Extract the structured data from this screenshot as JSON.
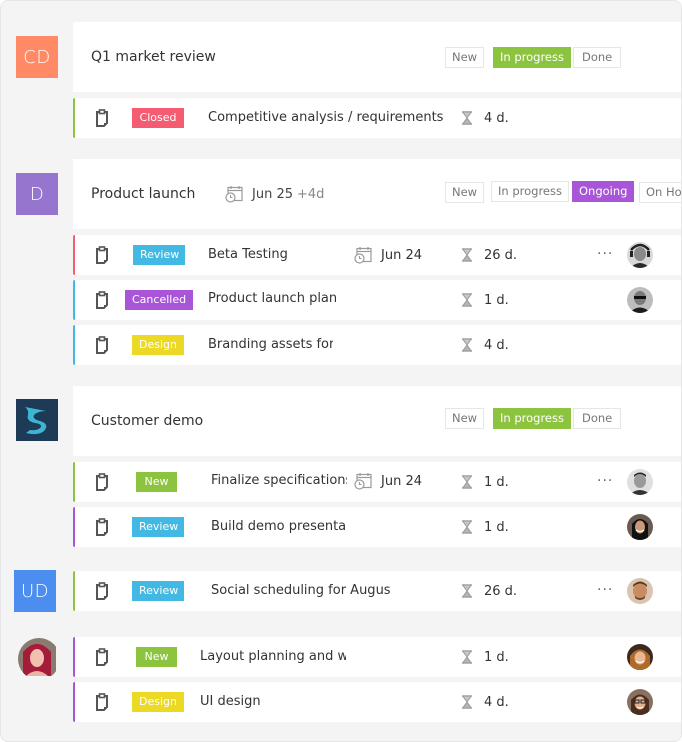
{
  "colors": {
    "green": "#8cc43f",
    "blue": "#41b9e3",
    "red": "#f55b71",
    "purple": "#a855d8",
    "yellow": "#ecd926",
    "orange_avatar": "#ff8a65",
    "purple_avatar": "#9575cd",
    "blue_avatar": "#4b8ef0"
  },
  "groups": [
    {
      "owner": {
        "initials": "CD",
        "type": "initials"
      },
      "title": "Q1 market review",
      "statuses": [
        {
          "label": "New",
          "active": false
        },
        {
          "label": "In progress",
          "active": true
        },
        {
          "label": "Done",
          "active": false
        }
      ],
      "tasks": [
        {
          "badge": "Closed",
          "name": "Competitive analysis / requirements",
          "duration": "4 d."
        }
      ]
    },
    {
      "owner": {
        "initials": "D",
        "type": "initials"
      },
      "title": "Product launch",
      "date": "Jun 25",
      "date_extra": "+4d",
      "statuses": [
        {
          "label": "New",
          "active": false
        },
        {
          "label": "In progress",
          "active": false
        },
        {
          "label": "Ongoing",
          "active": true
        },
        {
          "label": "On Hold",
          "active": false
        }
      ],
      "tasks": [
        {
          "badge": "Review",
          "name": "Beta Testing",
          "date": "Jun 24",
          "duration": "26 d.",
          "more": "···",
          "assignee": "man-headphones"
        },
        {
          "badge": "Cancelled",
          "name": "Product launch plan",
          "duration": "1 d.",
          "assignee": "man-glasses"
        },
        {
          "badge": "Design",
          "name": "Branding assets for",
          "duration": "4 d."
        }
      ]
    },
    {
      "owner": {
        "type": "logo",
        "logo_letter": "S"
      },
      "title": "Customer demo",
      "statuses": [
        {
          "label": "New",
          "active": false
        },
        {
          "label": "In progress",
          "active": true
        },
        {
          "label": "Done",
          "active": false
        }
      ],
      "tasks": [
        {
          "badge": "New",
          "name": "Finalize specifications",
          "date": "Jun 24",
          "duration": "1 d.",
          "more": "···",
          "assignee": "man-short-hair"
        },
        {
          "badge": "Review",
          "name": "Build demo presentati",
          "duration": "1 d.",
          "assignee": "woman-dark-hair"
        }
      ]
    },
    {
      "owner": {
        "initials": "UD",
        "type": "initials"
      },
      "tasks": [
        {
          "badge": "Review",
          "name": "Social scheduling for August",
          "duration": "26 d.",
          "more": "···",
          "assignee": "man-beard"
        }
      ]
    },
    {
      "owner": {
        "type": "photo",
        "photo": "woman-red-hair"
      },
      "tasks": [
        {
          "badge": "New",
          "name": "Layout planning and wir",
          "duration": "1 d.",
          "assignee": "woman-blonde"
        },
        {
          "badge": "Design",
          "name": "UI design",
          "duration": "4 d.",
          "assignee": "woman-glasses"
        }
      ]
    }
  ],
  "icons": {
    "task": "clipboard-icon",
    "date": "calendar-clock-icon",
    "duration": "hourglass-icon",
    "more": "more-horizontal-icon"
  }
}
